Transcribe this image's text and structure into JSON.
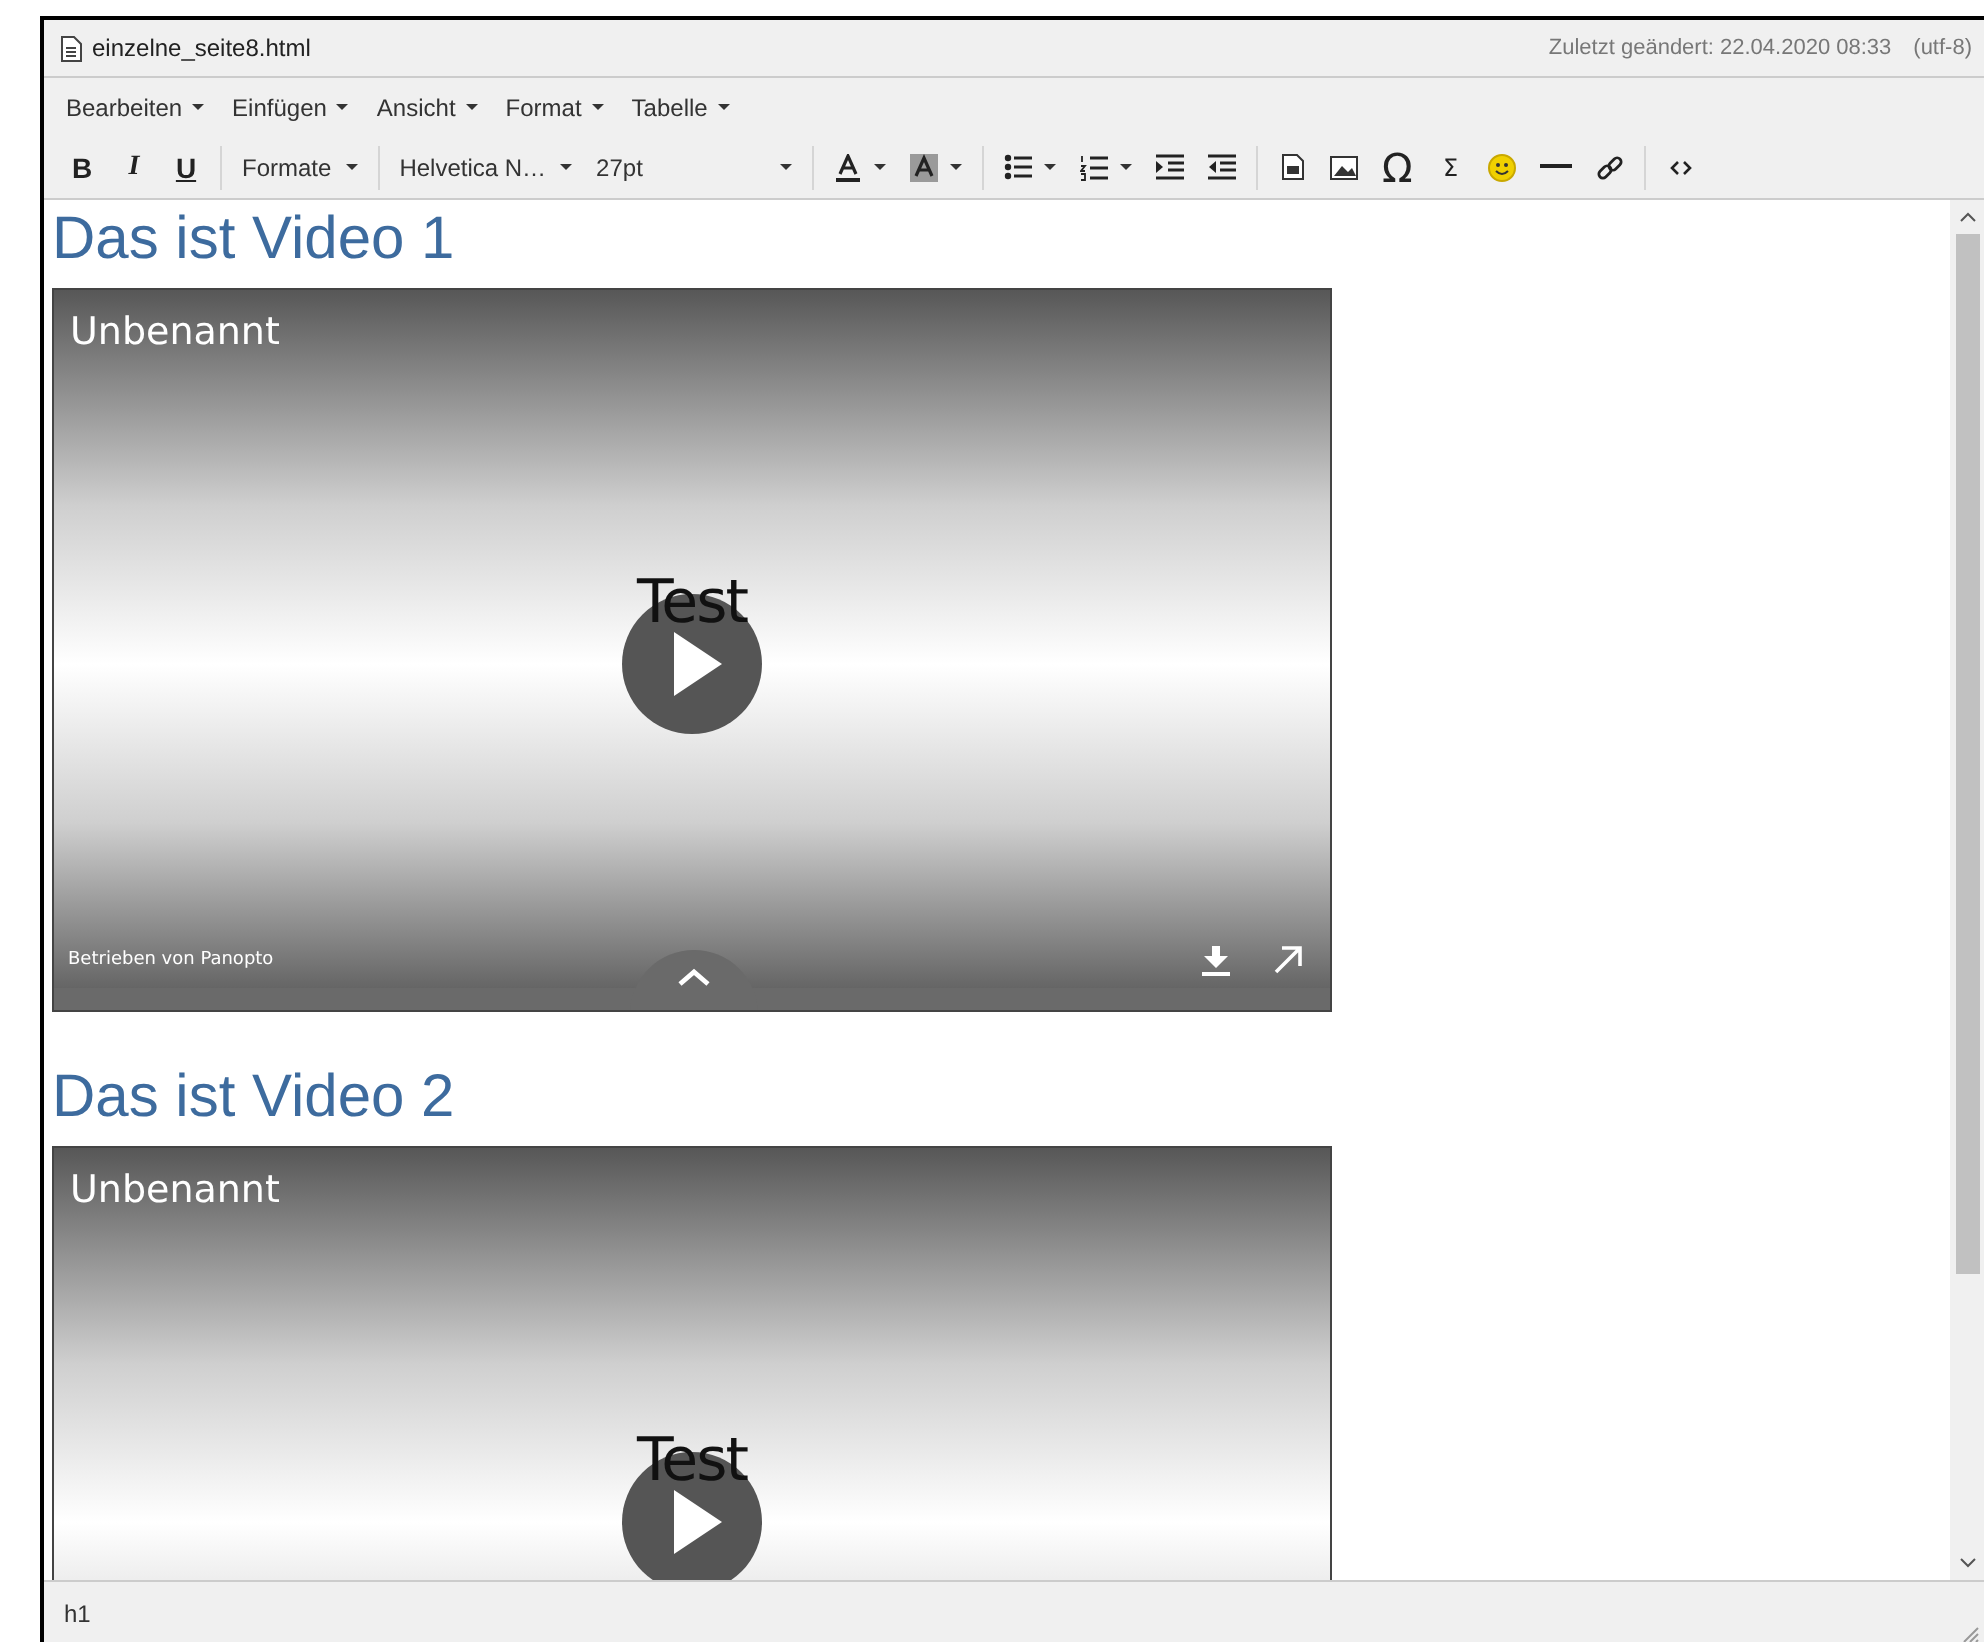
{
  "window": {
    "title": "einzelne_seite8.html",
    "modified": "Zuletzt geändert: 22.04.2020 08:33",
    "encoding": "(utf-8)"
  },
  "menu": [
    {
      "label": "Bearbeiten"
    },
    {
      "label": "Einfügen"
    },
    {
      "label": "Ansicht"
    },
    {
      "label": "Format"
    },
    {
      "label": "Tabelle"
    }
  ],
  "toolbar": {
    "formatting": [
      "B",
      "I",
      "U"
    ],
    "dropdowns": [
      "Formate",
      "Helvetica N…",
      "27pt"
    ],
    "symbols": [
      "Ω",
      "Σ"
    ]
  },
  "content": [
    {
      "kind": "heading",
      "text": "Das ist Video 1"
    },
    {
      "kind": "video",
      "title": "Unbenannt",
      "overlay": "Test",
      "credit": "Betrieben von Panopto"
    },
    {
      "kind": "heading",
      "text": "Das ist Video 2"
    },
    {
      "kind": "video",
      "title": "Unbenannt",
      "overlay": "Test"
    }
  ],
  "status_bar": {
    "path": "h1"
  }
}
